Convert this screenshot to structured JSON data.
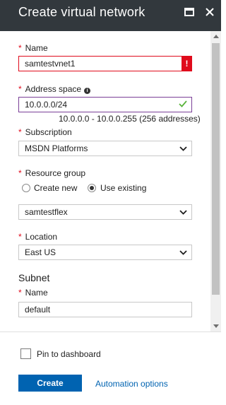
{
  "window": {
    "title": "Create virtual network"
  },
  "fields": {
    "name": {
      "label": "Name",
      "value": "samtestvnet1",
      "error_mark": "!"
    },
    "address_space": {
      "label": "Address space",
      "value": "10.0.0.0/24",
      "hint": "10.0.0.0 - 10.0.0.255 (256 addresses)"
    },
    "subscription": {
      "label": "Subscription",
      "selected": "MSDN Platforms"
    },
    "resource_group": {
      "label": "Resource group",
      "option_new": "Create new",
      "option_existing": "Use existing",
      "selected_option": "Use existing",
      "selected": "samtestflex"
    },
    "location": {
      "label": "Location",
      "selected": "East US"
    },
    "subnet": {
      "heading": "Subnet",
      "name_label": "Name",
      "name_value": "default"
    }
  },
  "footer": {
    "pin_label": "Pin to dashboard",
    "pin_checked": false,
    "create_label": "Create",
    "automation_label": "Automation options"
  },
  "colors": {
    "titlebar": "#32383d",
    "required": "#e00b1c",
    "primary": "#0063b1",
    "valid_border": "#7a3f97",
    "valid_check": "#5ab43c"
  }
}
